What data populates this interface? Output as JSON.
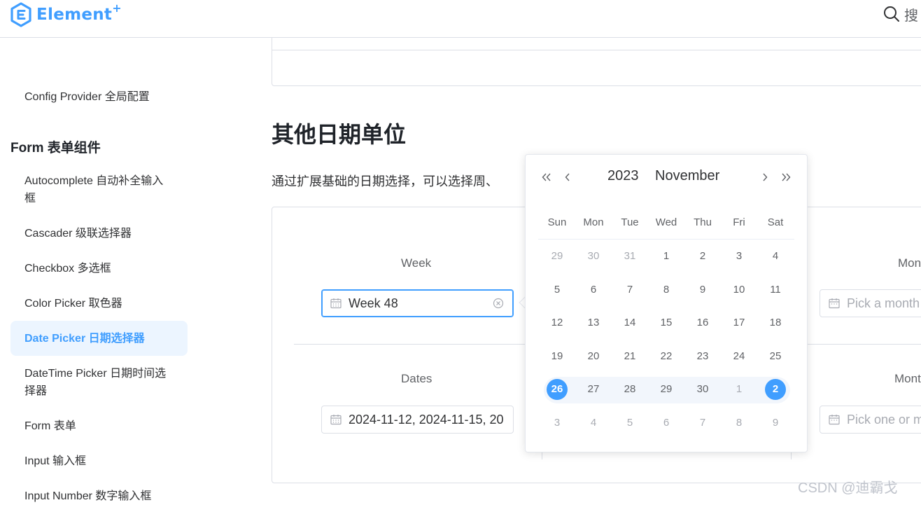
{
  "header": {
    "logo_text": "Element",
    "logo_plus": "+",
    "search_label": "搜"
  },
  "sidebar": {
    "items": [
      {
        "label": "Config Provider 全局配置"
      },
      {
        "label": "Autocomplete 自动补全输入框"
      },
      {
        "label": "Cascader 级联选择器"
      },
      {
        "label": "Checkbox 多选框"
      },
      {
        "label": "Color Picker 取色器"
      },
      {
        "label": "Date Picker 日期选择器",
        "active": true
      },
      {
        "label": "DateTime Picker 日期时间选择器"
      },
      {
        "label": "Form 表单"
      },
      {
        "label": "Input 输入框"
      },
      {
        "label": "Input Number 数字输入框"
      }
    ],
    "group_title": "Form 表单组件"
  },
  "main": {
    "section_title": "其他日期单位",
    "section_desc": "通过扩展基础的日期选择，可以选择周、",
    "week": {
      "label": "Week",
      "value": "Week 48"
    },
    "dates": {
      "label": "Dates",
      "value": "2024-11-12, 2024-11-15, 20"
    },
    "month": {
      "label": "Mon",
      "placeholder": "Pick a month"
    },
    "months": {
      "label": "Mont",
      "placeholder": "Pick one or m"
    }
  },
  "calendar": {
    "year": "2023",
    "month": "November",
    "weekdays": [
      "Sun",
      "Mon",
      "Tue",
      "Wed",
      "Thu",
      "Fri",
      "Sat"
    ],
    "rows": [
      [
        {
          "d": "29",
          "m": true
        },
        {
          "d": "30",
          "m": true
        },
        {
          "d": "31",
          "m": true
        },
        {
          "d": "1"
        },
        {
          "d": "2"
        },
        {
          "d": "3"
        },
        {
          "d": "4"
        }
      ],
      [
        {
          "d": "5"
        },
        {
          "d": "6"
        },
        {
          "d": "7"
        },
        {
          "d": "8"
        },
        {
          "d": "9"
        },
        {
          "d": "10"
        },
        {
          "d": "11"
        }
      ],
      [
        {
          "d": "12"
        },
        {
          "d": "13"
        },
        {
          "d": "14"
        },
        {
          "d": "15"
        },
        {
          "d": "16"
        },
        {
          "d": "17"
        },
        {
          "d": "18"
        }
      ],
      [
        {
          "d": "19"
        },
        {
          "d": "20"
        },
        {
          "d": "21"
        },
        {
          "d": "22"
        },
        {
          "d": "23"
        },
        {
          "d": "24"
        },
        {
          "d": "25"
        }
      ],
      [
        {
          "d": "26",
          "s": true
        },
        {
          "d": "27"
        },
        {
          "d": "28"
        },
        {
          "d": "29"
        },
        {
          "d": "30"
        },
        {
          "d": "1",
          "m": true
        },
        {
          "d": "2",
          "s": true
        }
      ],
      [
        {
          "d": "3",
          "m": true
        },
        {
          "d": "4",
          "m": true
        },
        {
          "d": "5",
          "m": true
        },
        {
          "d": "6",
          "m": true
        },
        {
          "d": "7",
          "m": true
        },
        {
          "d": "8",
          "m": true
        },
        {
          "d": "9",
          "m": true
        }
      ]
    ]
  },
  "watermark": "CSDN @迪霸戈",
  "colors": {
    "accent": "#409eff",
    "border": "#dcdfe6",
    "muted": "#a8abb2"
  }
}
